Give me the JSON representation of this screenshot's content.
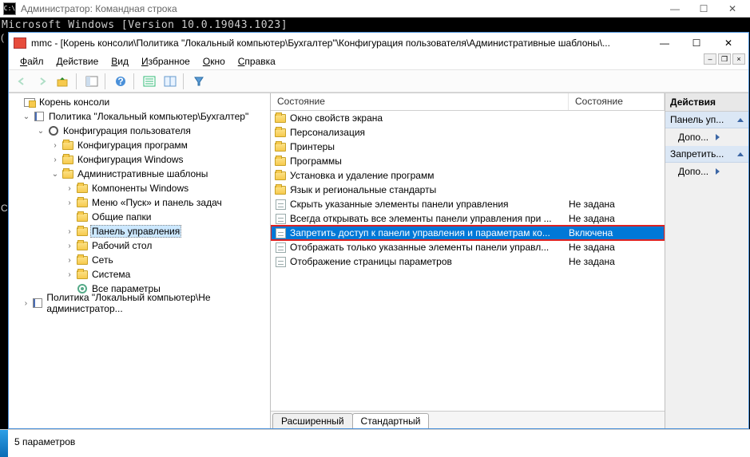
{
  "cmd": {
    "title": "Администратор: Командная строка",
    "console_text": "Microsoft Windows [Version 10.0.19043.1023]",
    "left_chars": [
      "(",
      "",
      "C"
    ]
  },
  "mmc": {
    "title": "mmc - [Корень консоли\\Политика \"Локальный компьютер\\Бухгалтер\"\\Конфигурация пользователя\\Административные шаблоны\\...",
    "menus": {
      "file": "Файл",
      "action": "Действие",
      "view": "Вид",
      "favorites": "Избранное",
      "window": "Окно",
      "help": "Справка"
    }
  },
  "tree": {
    "root": "Корень консоли",
    "policy1": "Политика \"Локальный компьютер\\Бухгалтер\"",
    "userconf": "Конфигурация пользователя",
    "confprog": "Конфигурация программ",
    "confwin": "Конфигурация Windows",
    "admtempl": "Административные шаблоны",
    "compwin": "Компоненты Windows",
    "startmenu": "Меню «Пуск» и панель задач",
    "sharedfolders": "Общие папки",
    "ctrlpanel": "Панель управления",
    "desktop": "Рабочий стол",
    "network": "Сеть",
    "system": "Система",
    "allsettings": "Все параметры",
    "policy2": "Политика \"Локальный компьютер\\Не администратор..."
  },
  "list": {
    "header_name": "Состояние",
    "header_state": "Состояние",
    "items": [
      {
        "name": "Окно свойств экрана",
        "state": "",
        "type": "folder"
      },
      {
        "name": "Персонализация",
        "state": "",
        "type": "folder"
      },
      {
        "name": "Принтеры",
        "state": "",
        "type": "folder"
      },
      {
        "name": "Программы",
        "state": "",
        "type": "folder"
      },
      {
        "name": "Установка и удаление программ",
        "state": "",
        "type": "folder"
      },
      {
        "name": "Язык и региональные стандарты",
        "state": "",
        "type": "folder"
      },
      {
        "name": "Скрыть указанные элементы панели управления",
        "state": "Не задана",
        "type": "setting"
      },
      {
        "name": "Всегда открывать все элементы панели управления при ...",
        "state": "Не задана",
        "type": "setting"
      },
      {
        "name": "Запретить доступ к панели управления и параметрам ко...",
        "state": "Включена",
        "type": "setting",
        "selected": true
      },
      {
        "name": "Отображать только указанные элементы панели управл...",
        "state": "Не задана",
        "type": "setting"
      },
      {
        "name": "Отображение страницы параметров",
        "state": "Не задана",
        "type": "setting"
      }
    ],
    "tabs": {
      "extended": "Расширенный",
      "standard": "Стандартный"
    }
  },
  "actions": {
    "header": "Действия",
    "group1": "Панель уп...",
    "more1": "Допо...",
    "group2": "Запретить...",
    "more2": "Допо..."
  },
  "status": "5 параметров"
}
